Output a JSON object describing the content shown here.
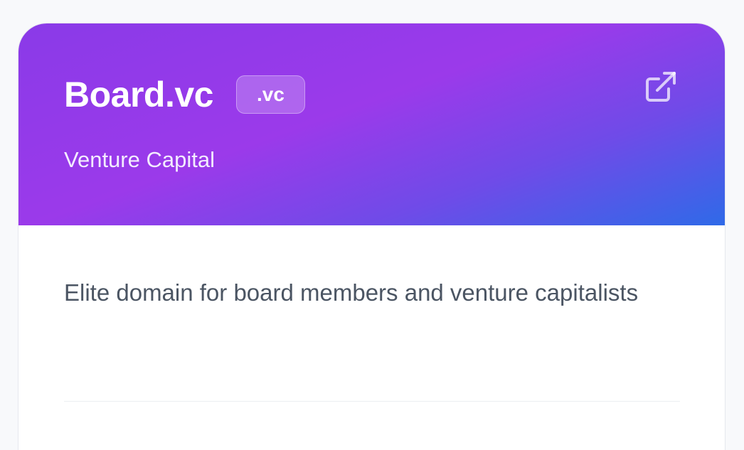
{
  "card": {
    "domain_name": "Board.vc",
    "tld_badge": ".vc",
    "category": "Venture Capital",
    "description": "Elite domain for board members and venture capitalists",
    "external_link_icon": "external-link-icon"
  },
  "colors": {
    "gradient_start": "#8a3ae8",
    "gradient_mid": "#9b3aea",
    "gradient_end": "#2f6ae8",
    "description_text": "#4b5563",
    "page_background": "#f8f9fb"
  }
}
